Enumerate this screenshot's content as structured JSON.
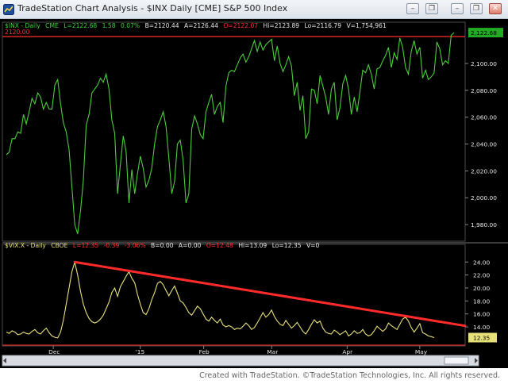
{
  "window": {
    "title": "TradeStation Chart Analysis - $INX Daily [CME] S&P 500 Index",
    "buttons": {
      "minimize": "–",
      "restore": "❐",
      "close": "✕"
    }
  },
  "upper_panel": {
    "header": {
      "symbol": "$INX - Daily",
      "exchange": "CME",
      "last": "L=2122.68",
      "change": "1.58",
      "pct": "0.07%",
      "bid": "B=2120.44",
      "ask": "A=2126.44",
      "open": "O=2122.07",
      "high": "Hi=2123.89",
      "low": "Lo=2116.79",
      "volume": "V=1,754,961"
    },
    "level_label": "2120.00",
    "last_tag": "2,122.68",
    "price_axis": [
      "2,100.00",
      "2,080.00",
      "2,060.00",
      "2,040.00",
      "2,020.00",
      "2,000.00",
      "1,980.00"
    ]
  },
  "lower_panel": {
    "header": {
      "symbol": "$VIX.X - Daily",
      "exchange": "CBOE",
      "last": "L=12.35",
      "change": "-0.39",
      "pct": "-3.06%",
      "bid": "B=0.00",
      "ask": "A=0.00",
      "open": "O=12.48",
      "high": "Hi=13.09",
      "low": "Lo=12.35",
      "volume": "V=0"
    },
    "last_tag": "12.35",
    "price_axis": [
      "24.00",
      "22.00",
      "20.00",
      "18.00",
      "16.00",
      "14.00"
    ]
  },
  "time_axis": [
    "Dec",
    "'15",
    "Feb",
    "Mar",
    "Apr",
    "May"
  ],
  "status_bar": {
    "credit": "Created with TradeStation. ©TradeStation Technologies, Inc. All rights reserved."
  },
  "colors": {
    "spx_line": "#4ccc3c",
    "vix_line": "#e8e07a",
    "trend_line": "#ff2a2a",
    "axis_text": "#e8e8e8",
    "header_green": "#3cd23c",
    "header_red": "#ff3030",
    "tag_green": "#22aa22",
    "tag_yellow": "#e6e07a"
  },
  "chart_data": [
    {
      "type": "line",
      "series": [
        {
          "name": "$INX - Daily",
          "values": [
            2032,
            2034,
            2044,
            2044,
            2049,
            2048,
            2062,
            2055,
            2064,
            2074,
            2070,
            2078,
            2075,
            2066,
            2071,
            2066,
            2066,
            2084,
            2088,
            2070,
            2056,
            2049,
            2036,
            2008,
            1980,
            1973,
            1990,
            2013,
            2054,
            2062,
            2078,
            2081,
            2084,
            2089,
            2086,
            2092,
            2081,
            2058,
            2048,
            2003,
            2025,
            2046,
            2034,
            1996,
            2021,
            2003,
            2018,
            2031,
            2022,
            2008,
            2013,
            2022,
            2040,
            2053,
            2058,
            2064,
            2053,
            2029,
            2003,
            2012,
            2040,
            2043,
            2028,
            1996,
            2003,
            2051,
            2061,
            2055,
            2047,
            2044,
            2064,
            2071,
            2077,
            2062,
            2068,
            2071,
            2056,
            2083,
            2093,
            2095,
            2094,
            2099,
            2104,
            2107,
            2101,
            2105,
            2111,
            2117,
            2109,
            2116,
            2110,
            2114,
            2116,
            2118,
            2102,
            2113,
            2100,
            2094,
            2099,
            2105,
            2098,
            2076,
            2086,
            2065,
            2076,
            2044,
            2049,
            2081,
            2080,
            2070,
            2091,
            2083,
            2075,
            2062,
            2081,
            2086,
            2058,
            2067,
            2085,
            2091,
            2081,
            2062,
            2075,
            2064,
            2079,
            2095,
            2093,
            2099,
            2092,
            2081,
            2096,
            2097,
            2102,
            2106,
            2112,
            2097,
            2108,
            2103,
            2119,
            2112,
            2097,
            2092,
            2109,
            2117,
            2107,
            2112,
            2089,
            2095,
            2088,
            2090,
            2093,
            2116,
            2111,
            2099,
            2102,
            2100,
            2121,
            2123
          ]
        }
      ],
      "ylim": [
        1970,
        2126
      ],
      "reference_level": 2120
    },
    {
      "type": "line",
      "series": [
        {
          "name": "$VIX.X - Daily",
          "values": [
            13.2,
            13.0,
            13.4,
            13.2,
            12.8,
            12.9,
            13.2,
            13.0,
            12.9,
            13.3,
            13.6,
            13.1,
            12.9,
            13.4,
            13.8,
            13.1,
            12.6,
            12.4,
            12.3,
            13.2,
            15.0,
            17.5,
            20.0,
            22.5,
            24.0,
            22.0,
            19.5,
            17.5,
            16.2,
            15.3,
            14.8,
            14.6,
            14.8,
            15.2,
            15.8,
            16.8,
            17.8,
            19.3,
            20.0,
            18.7,
            20.2,
            21.0,
            21.8,
            22.5,
            21.5,
            20.8,
            19.0,
            17.5,
            16.2,
            15.9,
            16.8,
            18.2,
            19.3,
            20.7,
            21.0,
            20.5,
            19.6,
            18.8,
            19.6,
            20.3,
            19.2,
            18.0,
            17.7,
            17.0,
            16.2,
            15.8,
            16.5,
            17.2,
            16.8,
            16.0,
            15.2,
            14.9,
            15.5,
            15.0,
            14.6,
            15.2,
            14.3,
            14.0,
            14.2,
            14.0,
            13.6,
            13.8,
            13.7,
            14.1,
            14.6,
            14.2,
            13.6,
            13.9,
            14.6,
            15.4,
            16.2,
            15.5,
            15.9,
            16.6,
            15.6,
            14.9,
            14.4,
            14.2,
            15.0,
            14.4,
            13.8,
            14.2,
            14.7,
            14.0,
            13.3,
            12.9,
            13.6,
            14.4,
            15.1,
            14.6,
            14.9,
            13.8,
            13.2,
            13.0,
            12.9,
            13.5,
            13.2,
            12.8,
            13.1,
            13.4,
            12.6,
            12.9,
            13.4,
            13.0,
            13.1,
            13.6,
            12.9,
            12.6,
            12.8,
            13.4,
            14.1,
            13.7,
            13.3,
            13.7,
            14.6,
            14.2,
            13.9,
            13.6,
            14.4,
            15.2,
            15.5,
            14.9,
            13.9,
            13.2,
            13.8,
            14.5,
            13.1,
            12.9,
            12.6,
            12.5,
            12.35
          ],
          "color": "#e8e07a"
        }
      ],
      "ylim": [
        11.8,
        25.5
      ],
      "trendline": [
        [
          24,
          24.0
        ],
        [
          159,
          14.3
        ]
      ]
    }
  ]
}
